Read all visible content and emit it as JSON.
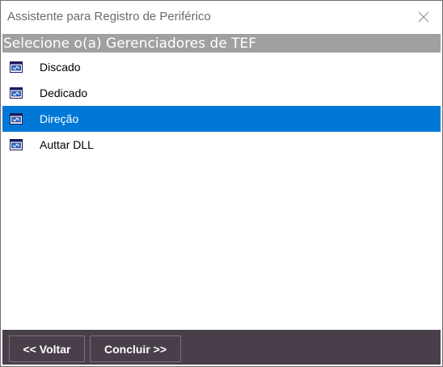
{
  "window": {
    "title": "Assistente para Registro de Periférico",
    "close_icon": "close-icon"
  },
  "header": {
    "text": "Selecione o(a) Gerenciadores de TEF",
    "bg_color": "#a0a0a0"
  },
  "list": {
    "items": [
      {
        "label": "Discado",
        "icon": "device-icon",
        "selected": false
      },
      {
        "label": "Dedicado",
        "icon": "device-icon",
        "selected": false
      },
      {
        "label": "Direção",
        "icon": "device-icon",
        "selected": true
      },
      {
        "label": "Auttar DLL",
        "icon": "device-icon",
        "selected": false
      }
    ],
    "selected_color": "#0078d7"
  },
  "footer": {
    "back_label": "<< Voltar",
    "finish_label": "Concluir >>",
    "bg_color": "#493f4a"
  }
}
